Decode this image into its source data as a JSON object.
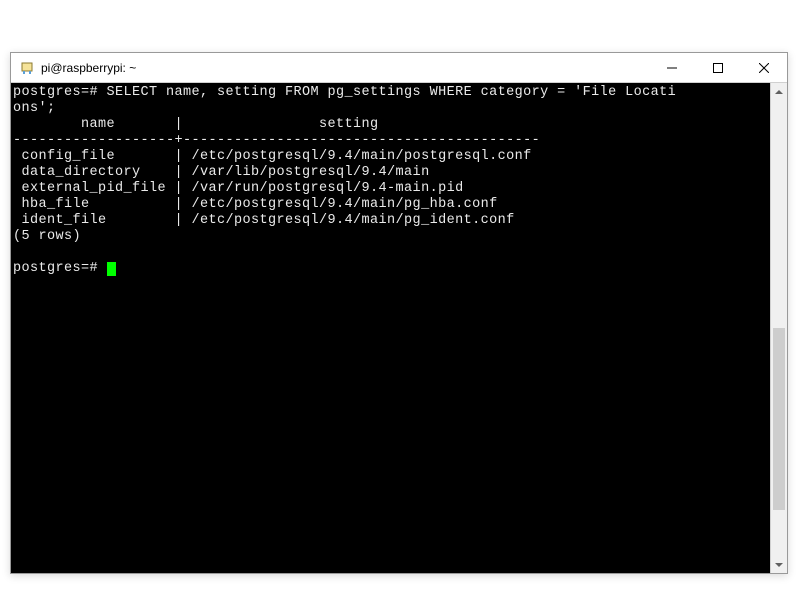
{
  "window": {
    "title": "pi@raspberrypi: ~"
  },
  "terminal": {
    "prompt1": "postgres=# ",
    "sql_line1": "SELECT name, setting FROM pg_settings WHERE category = 'File Locati",
    "sql_line2": "ons';",
    "col1_header": "name",
    "col2_header": "setting",
    "divider": "-------------------+------------------------------------------",
    "rows": [
      {
        "name": "config_file",
        "setting": "/etc/postgresql/9.4/main/postgresql.conf"
      },
      {
        "name": "data_directory",
        "setting": "/var/lib/postgresql/9.4/main"
      },
      {
        "name": "external_pid_file",
        "setting": "/var/run/postgresql/9.4-main.pid"
      },
      {
        "name": "hba_file",
        "setting": "/etc/postgresql/9.4/main/pg_hba.conf"
      },
      {
        "name": "ident_file",
        "setting": "/etc/postgresql/9.4/main/pg_ident.conf"
      }
    ],
    "rowcount": "(5 rows)",
    "prompt2": "postgres=# "
  },
  "scrollbar": {
    "thumb_top_pct": 50,
    "thumb_height_pct": 40
  }
}
